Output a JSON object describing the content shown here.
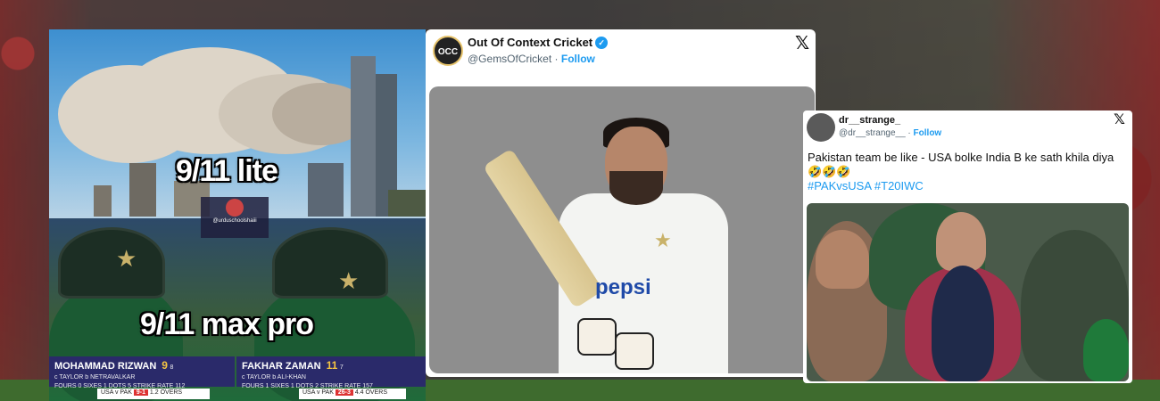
{
  "meme": {
    "caption_top": "9/11 lite",
    "caption_bottom": "9/11 max pro",
    "watermark_text": "@urduschoolshaiii",
    "scorecard_left": {
      "player": "MOHAMMAD RIZWAN",
      "runs": "9",
      "balls": "8",
      "dismissal": "c TAYLOR b NETRAVALKAR",
      "stats": "FOURS 0   SIXES 1   DOTS 5   STRIKE RATE 112",
      "match": "USA v PAK",
      "score": "9-1",
      "overs": "1.2 OVERS"
    },
    "scorecard_right": {
      "player": "FAKHAR ZAMAN",
      "runs": "11",
      "balls": "7",
      "dismissal": "c TAYLOR b ALI-KHAN",
      "stats": "FOURS 1   SIXES 1   DOTS 2   STRIKE RATE 157",
      "match": "USA v PAK",
      "score": "26-3",
      "overs": "4.4 OVERS"
    }
  },
  "tweet_main": {
    "name": "Out Of Context Cricket",
    "avatar_text": "OCC",
    "handle": "@GemsOfCricket",
    "separator": " · ",
    "follow": "Follow",
    "jersey_text": "pepsi"
  },
  "tweet_small": {
    "name": "dr__strange_",
    "handle": "@dr__strange__",
    "separator": " · ",
    "follow": "Follow",
    "text": "Pakistan team be like - USA bolke India B ke sath khila diya 🤣🤣🤣",
    "hashtags": "#PAKvsUSA #T20IWC"
  },
  "icons": {
    "close": "x-logo-icon",
    "verified": "verified-badge-icon"
  },
  "colors": {
    "link": "#1d9bf0",
    "caption": "#ffffff"
  }
}
